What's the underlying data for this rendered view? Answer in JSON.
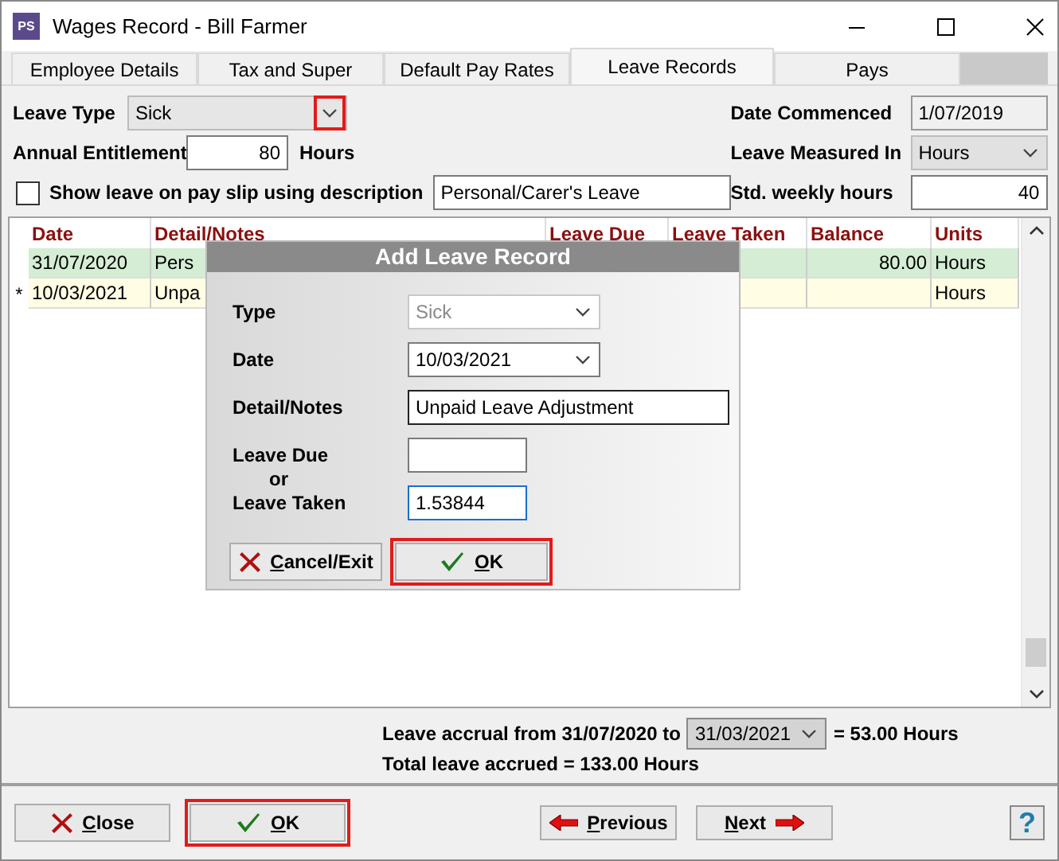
{
  "window": {
    "icon_text": "PS",
    "title": "Wages Record - Bill Farmer"
  },
  "tabs": [
    {
      "label": "Employee Details",
      "selected": false
    },
    {
      "label": "Tax and Super",
      "selected": false
    },
    {
      "label": "Default Pay Rates",
      "selected": false
    },
    {
      "label": "Leave Records",
      "selected": true
    },
    {
      "label": "Pays",
      "selected": false
    }
  ],
  "leave_type": {
    "label": "Leave Type",
    "value": "Sick",
    "highlighted": true
  },
  "date_commenced": {
    "label": "Date Commenced",
    "value": "1/07/2019"
  },
  "annual_entitlement": {
    "label": "Annual Entitlement",
    "value": "80",
    "unit": "Hours"
  },
  "leave_measured_in": {
    "label": "Leave Measured In",
    "value": "Hours"
  },
  "show_on_payslip": {
    "label": "Show leave on pay slip using description",
    "checked": false,
    "description": "Personal/Carer's Leave"
  },
  "std_weekly_hours": {
    "label": "Std. weekly hours",
    "value": "40"
  },
  "table": {
    "columns": [
      "Date",
      "Detail/Notes",
      "Leave Due",
      "Leave Taken",
      "Balance",
      "Units"
    ],
    "rows": [
      {
        "kind": "saved",
        "date": "31/07/2020",
        "detail": "Pers",
        "balance": "80.00",
        "units": "Hours"
      },
      {
        "kind": "new",
        "marker": "*",
        "date": "10/03/2021",
        "detail": "Unpa",
        "units": "Hours"
      }
    ]
  },
  "accrual": {
    "prefix": "Leave accrual from 31/07/2020 to",
    "date": "31/03/2021",
    "suffix": "= 53.00 Hours",
    "total": "Total leave accrued = 133.00 Hours"
  },
  "dialog": {
    "title": "Add Leave Record",
    "type": {
      "label": "Type",
      "value": "Sick",
      "disabled": true
    },
    "date": {
      "label": "Date",
      "value": "10/03/2021"
    },
    "detail": {
      "label": "Detail/Notes",
      "value": "Unpaid Leave Adjustment"
    },
    "leave_due": {
      "label": "Leave Due",
      "or": "or"
    },
    "leave_taken": {
      "label": "Leave Taken",
      "value": "1.53844",
      "focused": true
    },
    "buttons": [
      {
        "kind": "cancel",
        "accel": "C",
        "rest": "ancel/Exit",
        "highlighted": false
      },
      {
        "kind": "ok",
        "accel": "O",
        "rest": "K",
        "highlighted": true
      }
    ]
  },
  "footer": {
    "buttons": [
      {
        "kind": "close",
        "accel": "C",
        "rest": "lose",
        "highlighted": false
      },
      {
        "kind": "ok",
        "accel": "O",
        "rest": "K",
        "highlighted": true
      },
      {
        "kind": "previous",
        "accel": "P",
        "rest": "revious",
        "highlighted": false
      },
      {
        "kind": "next",
        "accel": "N",
        "rest": "ext",
        "highlighted": false
      }
    ],
    "help": "?"
  }
}
